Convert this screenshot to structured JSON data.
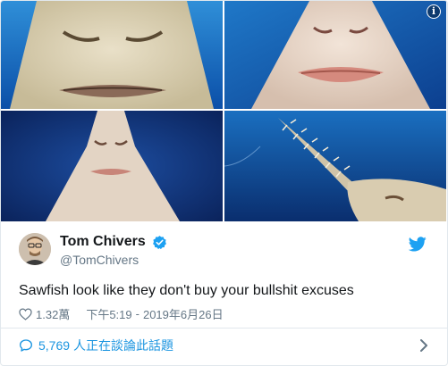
{
  "tweet": {
    "display_name": "Tom Chivers",
    "handle": "@TomChivers",
    "text": "Sawfish look like they don't buy your bullshit excuses",
    "likes": "1.32萬",
    "time": "下午5:19",
    "separator": "-",
    "date": "2019年6月26日",
    "replies_count": "5,769",
    "replies_label": "人正在談論此話題"
  },
  "icons": {
    "info": "info-icon",
    "verified": "verified-badge-icon",
    "twitter_logo": "twitter-bird-icon",
    "like": "heart-icon",
    "reply": "speech-bubble-icon",
    "chevron": "chevron-right-icon"
  },
  "colors": {
    "accent": "#1da1f2",
    "link": "#1b95e0",
    "secondary_text": "#657786",
    "ocean_dark": "#0a2e6e",
    "ocean_light": "#1a6fc0"
  }
}
